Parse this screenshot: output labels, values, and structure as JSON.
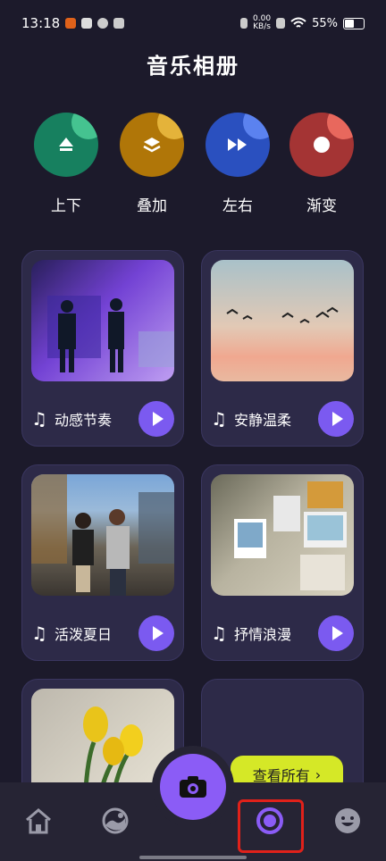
{
  "status": {
    "time": "13:18",
    "speed_value": "0.00",
    "speed_unit": "KB/s",
    "battery": "55%"
  },
  "page": {
    "title": "音乐相册"
  },
  "effects": [
    {
      "label": "上下",
      "icon": "up-arrow-icon",
      "color": "#1a8f6e",
      "shine": "#55d9a0"
    },
    {
      "label": "叠加",
      "icon": "layers-icon",
      "color": "#c88a0c",
      "shine": "#f5c84b"
    },
    {
      "label": "左右",
      "icon": "fast-forward-icon",
      "color": "#2f5bd1",
      "shine": "#6c93ff"
    },
    {
      "label": "渐变",
      "icon": "record-dot-icon",
      "color": "#b43a3a",
      "shine": "#ff7a6b"
    }
  ],
  "templates": [
    {
      "name": "动感节奏"
    },
    {
      "name": "安静温柔"
    },
    {
      "name": "活泼夏日"
    },
    {
      "name": "抒情浪漫"
    }
  ],
  "see_all": {
    "label": "查看所有"
  },
  "nav": {
    "items": [
      "home-icon",
      "gallery-icon",
      "camera-icon",
      "record-icon",
      "smiley-icon"
    ],
    "accent": "#8b5cf6"
  }
}
